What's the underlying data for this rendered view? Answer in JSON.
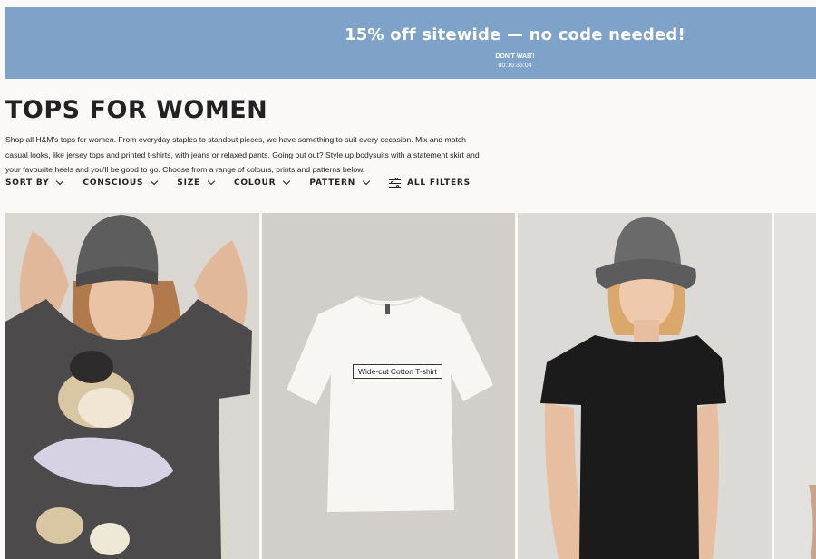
{
  "promo": {
    "title": "15% off sitewide — no code needed!",
    "subtitle": "DON'T WAIT!",
    "countdown": "00:16:36:04",
    "background": "#7ea2c8"
  },
  "page": {
    "title": "TOPS FOR WOMEN",
    "intro": {
      "part1": "Shop all H&M's tops for women. From everyday staples to standout pieces, we have something to suit every occasion. Mix and match casual looks, like jersey tops and printed ",
      "link1": "t-shirts",
      "part2": ", with jeans or relaxed pants. Going out out? Style up ",
      "link2": "bodysuits",
      "part3": " with a statement skirt and your favourite heels and you'll be good to go. Choose from a range of colours, prints and patterns below."
    }
  },
  "filters": {
    "sort_by": "SORT BY",
    "conscious": "CONSCIOUS",
    "size": "SIZE",
    "colour": "COLOUR",
    "pattern": "PATTERN",
    "all_filters": "ALL FILTERS"
  },
  "products": [
    {
      "alt": "Woman in grey beanie wearing dark grey oversized Minnie Mouse print t-shirt"
    },
    {
      "alt": "White wide-cut cotton t-shirt on light grey background"
    },
    {
      "alt": "Woman in grey bucket hat wearing black t-shirt"
    },
    {
      "alt": "Partial product image"
    }
  ],
  "tooltip": "Wide-cut Cotton T-shirt"
}
